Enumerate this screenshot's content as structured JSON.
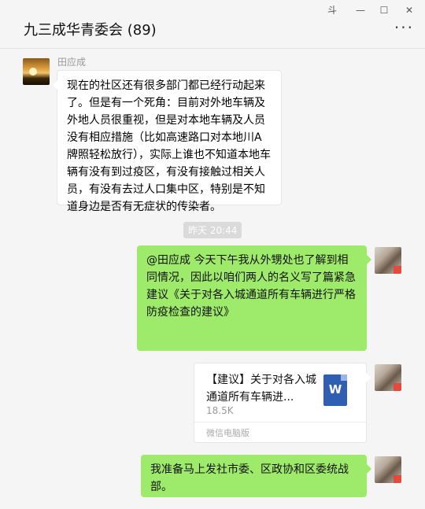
{
  "window": {
    "title": "九三成华青委会 (89)",
    "controls": {
      "pin": "⽃",
      "minimize": "—",
      "maximize": "☐",
      "close": "✕"
    },
    "more": "···"
  },
  "messages": {
    "first": {
      "sender": "田应成",
      "text": "现在的社区还有很多部门都已经行动起来了。但是有一个死角：目前对外地车辆及外地人员很重视，但是对本地车辆及人员没有相应措施（比如高速路口对本地川A牌照轻松放行），实际上谁也不知道本地车辆有没有到过疫区，有没有接触过相关人员，有没有去过人口集中区，特别是不知道身边是否有无症状的传染者。"
    },
    "timestamp": "昨天 20:44",
    "second": {
      "text": "@田应成 今天下午我从外甥处也了解到相同情况，因此以咱们两人的名义写了篇紧急建议《关于对各入城通道所有车辆进行严格防疫检查的建议》"
    },
    "file": {
      "name": "【建议】关于对各入城通道所有车辆进...",
      "size": "18.5K",
      "icon_letter": "W",
      "source": "微信电脑版"
    },
    "third": {
      "text": "我准备马上发社市委、区政协和区委统战部。"
    }
  }
}
